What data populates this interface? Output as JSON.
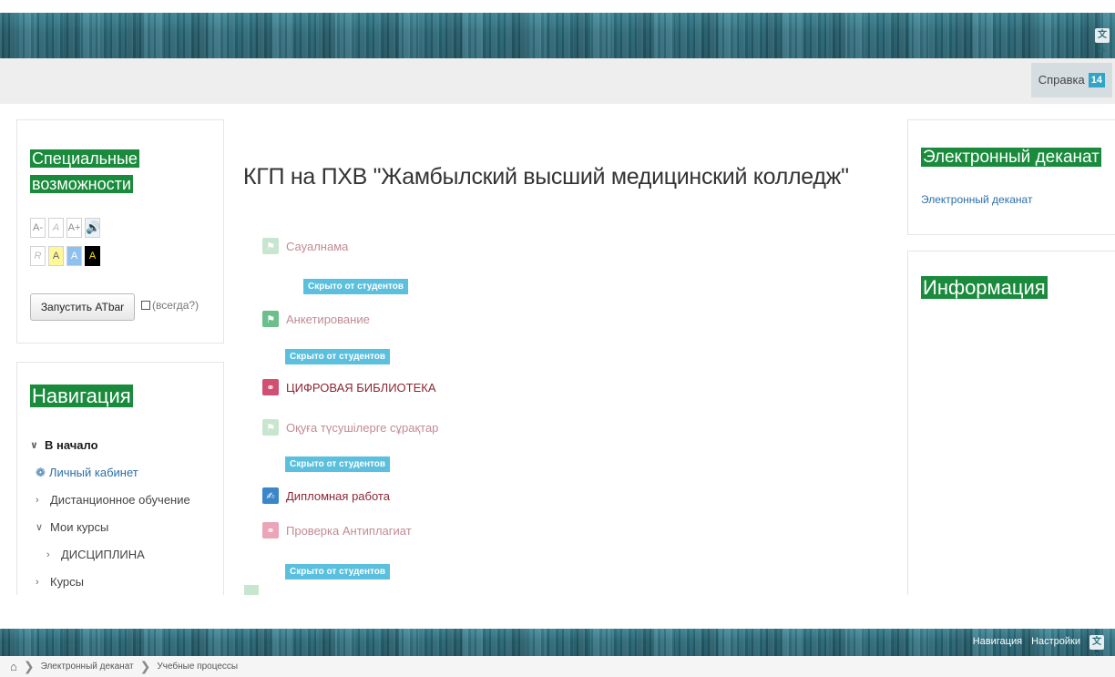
{
  "header": {
    "lang_icon": "文A",
    "help_label": "Справка",
    "help_badge": "14"
  },
  "accessibility": {
    "title": "Специальные возможности",
    "font_buttons": [
      "A-",
      "A",
      "A+"
    ],
    "speaker_icon": "speaker-icon",
    "color_buttons": [
      "R",
      "A",
      "A",
      "A"
    ],
    "atbar_label": "Запустить ATbar",
    "always_label": "(всегда?)"
  },
  "navigation": {
    "title": "Навигация",
    "items": [
      {
        "label": "В начало",
        "level": 0,
        "expanded": true
      },
      {
        "label": "Личный кабинет",
        "level": 1
      },
      {
        "label": "Дистанционное обучение",
        "level": 1
      },
      {
        "label": "Мои курсы",
        "level": 1,
        "expanded": true
      },
      {
        "label": "ДИСЦИПЛИНА",
        "level": 2
      },
      {
        "label": "Курсы",
        "level": 1
      }
    ]
  },
  "main": {
    "title": "КГП на ПХВ \"Жамбылский высший медицинский колледж\"",
    "hidden_badge": "Скрыто от студентов",
    "activities": [
      {
        "label": "Сауалнама",
        "icon": "feedback-icon",
        "hidden": true
      },
      {
        "label": "Анкетирование",
        "icon": "feedback-icon",
        "hidden": true
      },
      {
        "label": "ЦИФРОВАЯ БИБЛИОТЕКА",
        "icon": "url-icon",
        "hidden": false
      },
      {
        "label": "Оқуға түсушілерге сұрақтар",
        "icon": "feedback-icon",
        "hidden": true
      },
      {
        "label": "Дипломная работа",
        "icon": "assignment-icon",
        "hidden": false
      },
      {
        "label": "Проверка Антиплагиат",
        "icon": "url-icon",
        "hidden": true
      }
    ]
  },
  "right": {
    "deanat_title": "Электронный деканат",
    "deanat_link": "Электронный деканат",
    "info_title": "Информация"
  },
  "bottom": {
    "nav_label": "Навигация",
    "settings_label": "Настройки",
    "lang_icon": "文A"
  },
  "breadcrumb": {
    "home_icon": "home-icon",
    "items": [
      "Электронный деканат",
      "Учебные процессы"
    ]
  },
  "colors": {
    "brand_green": "#1a8b3c",
    "header_teal": "#2d6f7e",
    "hidden_badge": "#5bc0de",
    "link_blue": "#2a6fa8"
  }
}
